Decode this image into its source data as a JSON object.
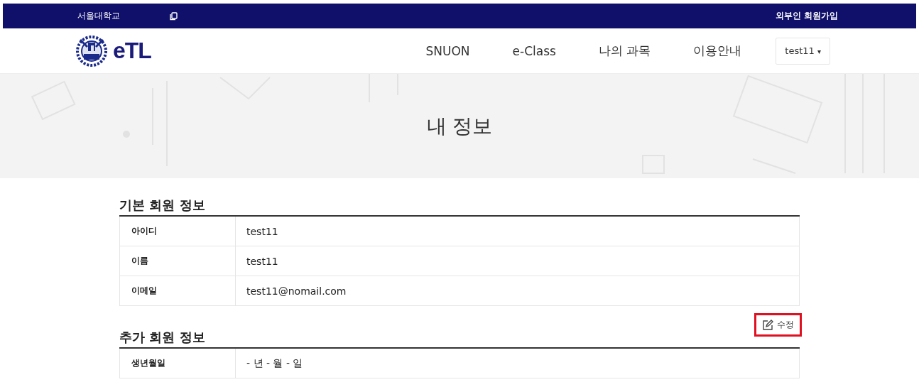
{
  "top_bar": {
    "university": "서울대학교",
    "signup_link": "외부인 회원가입"
  },
  "header": {
    "logo_text": "eTL",
    "nav": [
      {
        "label": "SNUON"
      },
      {
        "label": "e-Class"
      },
      {
        "label": "나의 과목"
      },
      {
        "label": "이용안내"
      }
    ],
    "user_menu": {
      "label": "test11",
      "caret": "▾"
    }
  },
  "banner": {
    "title": "내 정보"
  },
  "sections": [
    {
      "title": "기본 회원 정보",
      "rows": [
        {
          "label": "아이디",
          "value": "test11"
        },
        {
          "label": "이름",
          "value": "test11"
        },
        {
          "label": "이메일",
          "value": "test11@nomail.com"
        }
      ]
    },
    {
      "title": "추가 회원 정보",
      "edit_button": {
        "label": "수정",
        "highlighted": true
      },
      "rows": [
        {
          "label": "생년월일",
          "value": "- 년 - 월 - 일"
        }
      ]
    }
  ]
}
